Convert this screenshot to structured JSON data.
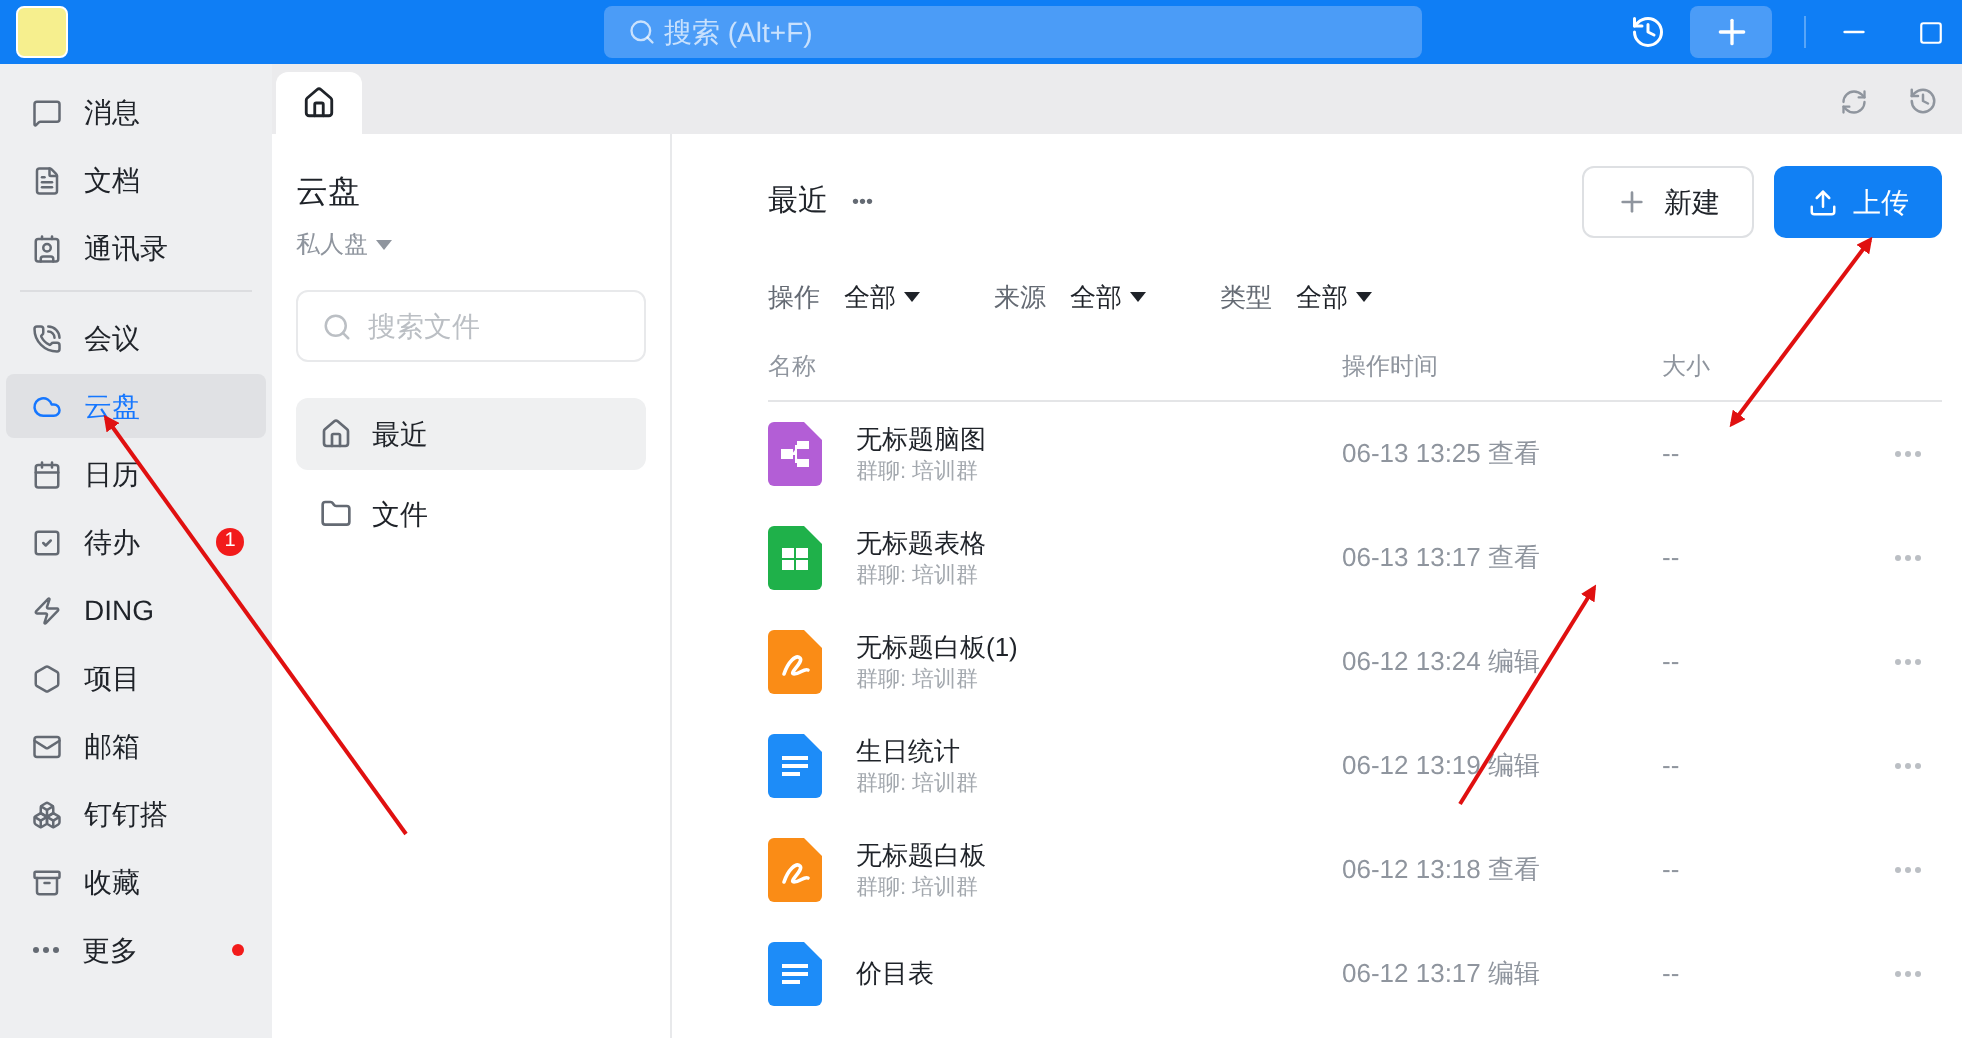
{
  "titlebar": {
    "search": {
      "placeholder": "搜索 (Alt+F)"
    }
  },
  "sidebar": {
    "groups": [
      [
        {
          "label": "消息",
          "selected": false,
          "dot": false
        },
        {
          "label": "文档",
          "selected": false,
          "dot": false
        },
        {
          "label": "通讯录",
          "selected": false,
          "dot": false
        }
      ],
      [
        {
          "label": "会议",
          "selected": false,
          "dot": false
        },
        {
          "label": "云盘",
          "selected": true,
          "dot": false
        },
        {
          "label": "日历",
          "selected": false,
          "dot": false
        },
        {
          "label": "待办",
          "selected": false,
          "dot": false,
          "badge": "1"
        },
        {
          "label": "DING",
          "selected": false,
          "dot": false
        },
        {
          "label": "项目",
          "selected": false,
          "dot": false
        },
        {
          "label": "邮箱",
          "selected": false,
          "dot": false
        },
        {
          "label": "钉钉搭",
          "selected": false,
          "dot": false
        },
        {
          "label": "收藏",
          "selected": false,
          "dot": false
        },
        {
          "label": "更多",
          "selected": false,
          "dot": true
        }
      ]
    ]
  },
  "panel": {
    "title": "云盘",
    "subtitle": "私人盘",
    "search": {
      "placeholder": "搜索文件"
    },
    "nav": [
      {
        "label": "最近",
        "selected": true
      },
      {
        "label": "文件",
        "selected": false
      }
    ]
  },
  "main": {
    "title": "最近",
    "more": "•••",
    "buttons": [
      {
        "label": "新建",
        "kind": "plain"
      },
      {
        "label": "上传",
        "kind": "primary"
      }
    ],
    "filters": [
      {
        "label": "操作",
        "value": "全部"
      },
      {
        "label": "来源",
        "value": "全部"
      },
      {
        "label": "类型",
        "value": "全部"
      }
    ],
    "table": {
      "columns": [
        "名称",
        "操作时间",
        "大小"
      ],
      "rows": [
        {
          "kind": "mindmap",
          "name": "无标题脑图",
          "source": "群聊: 培训群",
          "time": "06-13 13:25 查看",
          "size": "--"
        },
        {
          "kind": "sheet",
          "name": "无标题表格",
          "source": "群聊: 培训群",
          "time": "06-13 13:17 查看",
          "size": "--"
        },
        {
          "kind": "whiteboard",
          "name": "无标题白板(1)",
          "source": "群聊: 培训群",
          "time": "06-12 13:24 编辑",
          "size": "--"
        },
        {
          "kind": "doc",
          "name": "生日统计",
          "source": "群聊: 培训群",
          "time": "06-12 13:19 编辑",
          "size": "--"
        },
        {
          "kind": "whiteboard",
          "name": "无标题白板",
          "source": "群聊: 培训群",
          "time": "06-12 13:18 查看",
          "size": "--"
        },
        {
          "kind": "doc",
          "name": "价目表",
          "time": "06-12 13:17 编辑",
          "size": "--"
        }
      ]
    }
  }
}
